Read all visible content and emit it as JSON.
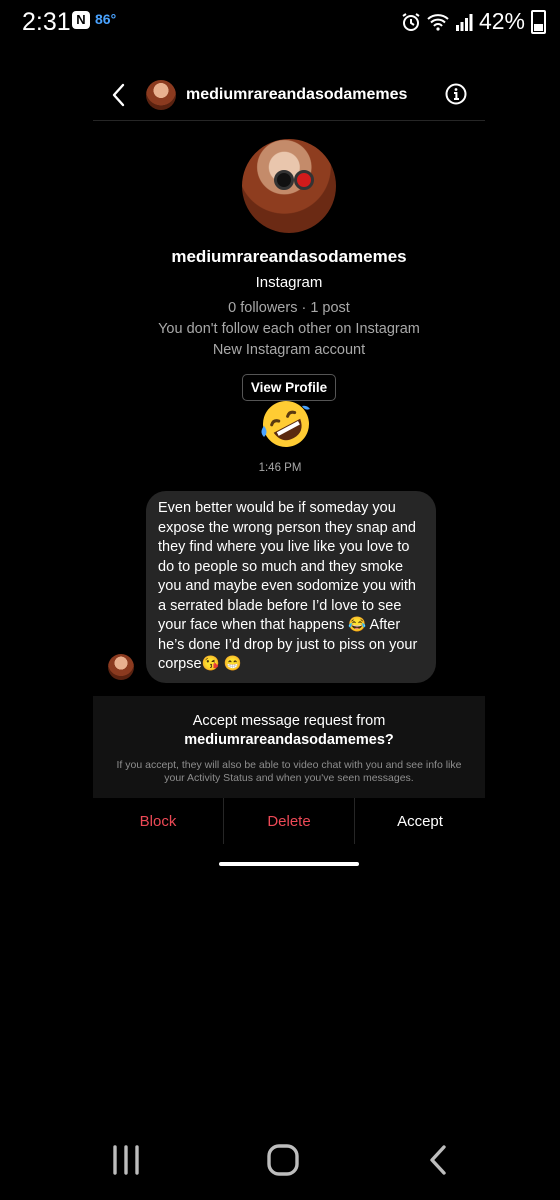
{
  "status": {
    "time": "2:31",
    "temp": "86°",
    "battery": "42%"
  },
  "header": {
    "username": "mediumrareandasodamemes"
  },
  "profile": {
    "name": "mediumrareandasodamemes",
    "platform": "Instagram",
    "stats": "0 followers · 1 post",
    "follow_note": "You don't follow each other on Instagram",
    "account_note": "New Instagram account",
    "view_profile": "View Profile"
  },
  "conversation": {
    "timestamp": "1:46 PM",
    "message": "Even better would be if someday you expose the wrong person they snap and they find where you live like you love to do to people so much and they smoke you and maybe even sodomize you with a serrated blade before I’d love to see your face when that happens 😂 After he’s done I’d drop by just to piss on your corpse😘 😁"
  },
  "request": {
    "title_prefix": "Accept message request from",
    "title_user": "mediumrareandasodamemes?",
    "note": "If you accept, they will also be able to video chat with you and see info like your Activity Status and when you've seen messages."
  },
  "actions": {
    "block": "Block",
    "delete": "Delete",
    "accept": "Accept"
  },
  "colors": {
    "danger": "#ed4956",
    "bubble": "#262626",
    "muted": "#a8a8a8"
  },
  "icons": [
    "back-icon",
    "info-icon",
    "emoji-rofl-icon",
    "recents-icon",
    "home-icon",
    "nav-back-icon"
  ]
}
